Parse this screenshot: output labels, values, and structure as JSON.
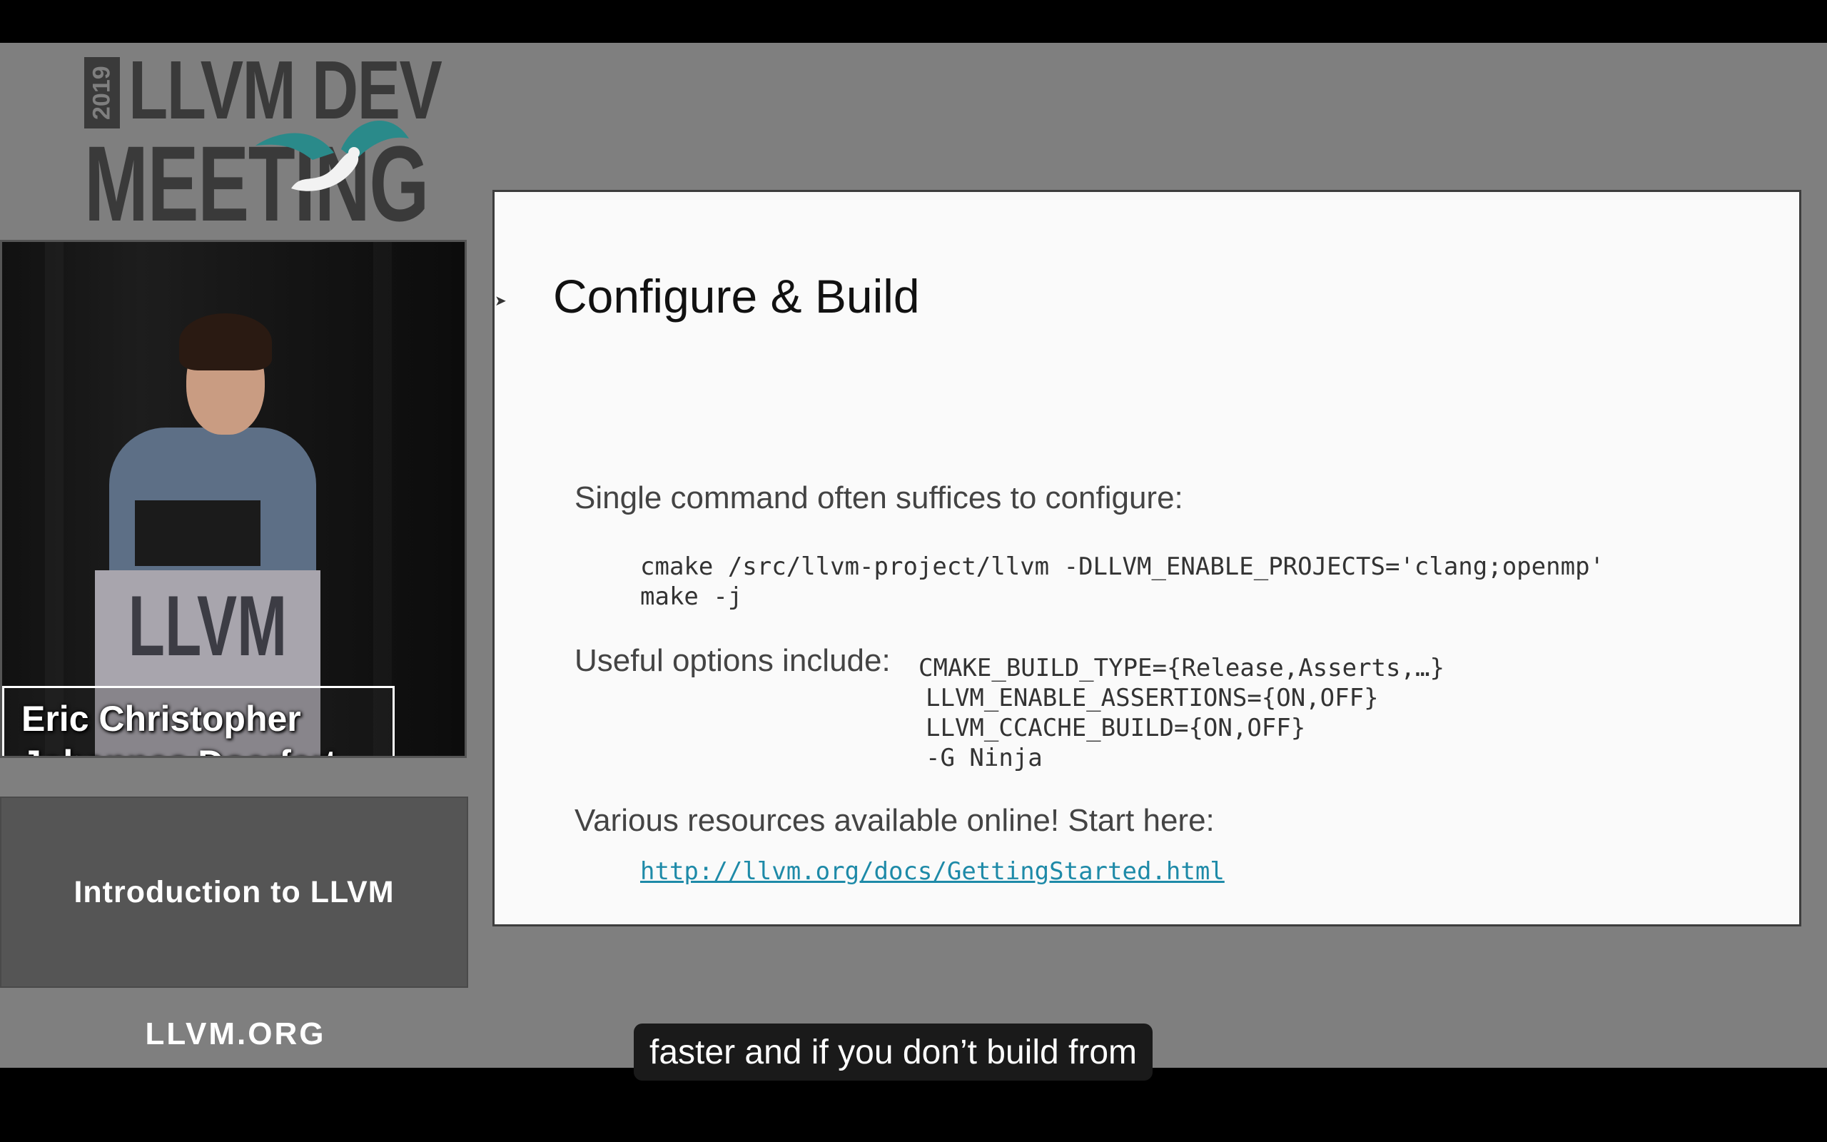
{
  "logo": {
    "year": "2019",
    "line1": "LLVM DEV",
    "line2": "MEETING"
  },
  "video": {
    "podium_text": "LLVM",
    "speakers": [
      "Eric Christopher",
      "Johannes Doerfert"
    ]
  },
  "talk_title": "Introduction to LLVM",
  "org": "LLVM.ORG",
  "slide": {
    "title": "Configure & Build",
    "para1": "Single command often suffices to configure:",
    "code1": "cmake /src/llvm-project/llvm -DLLVM_ENABLE_PROJECTS='clang;openmp'\nmake -j",
    "para2": "Useful options include:",
    "options": [
      "CMAKE_BUILD_TYPE={Release,Asserts,…}",
      "LLVM_ENABLE_ASSERTIONS={ON,OFF}",
      "LLVM_CCACHE_BUILD={ON,OFF}",
      "-G Ninja"
    ],
    "para3": "Various resources available online! Start here:",
    "link": "http://llvm.org/docs/GettingStarted.html"
  },
  "subtitle": "faster and if you don’t build from",
  "colors": {
    "background": "#7f7f7f",
    "accent_teal": "#2a8a8a",
    "link": "#1e8aa8"
  }
}
